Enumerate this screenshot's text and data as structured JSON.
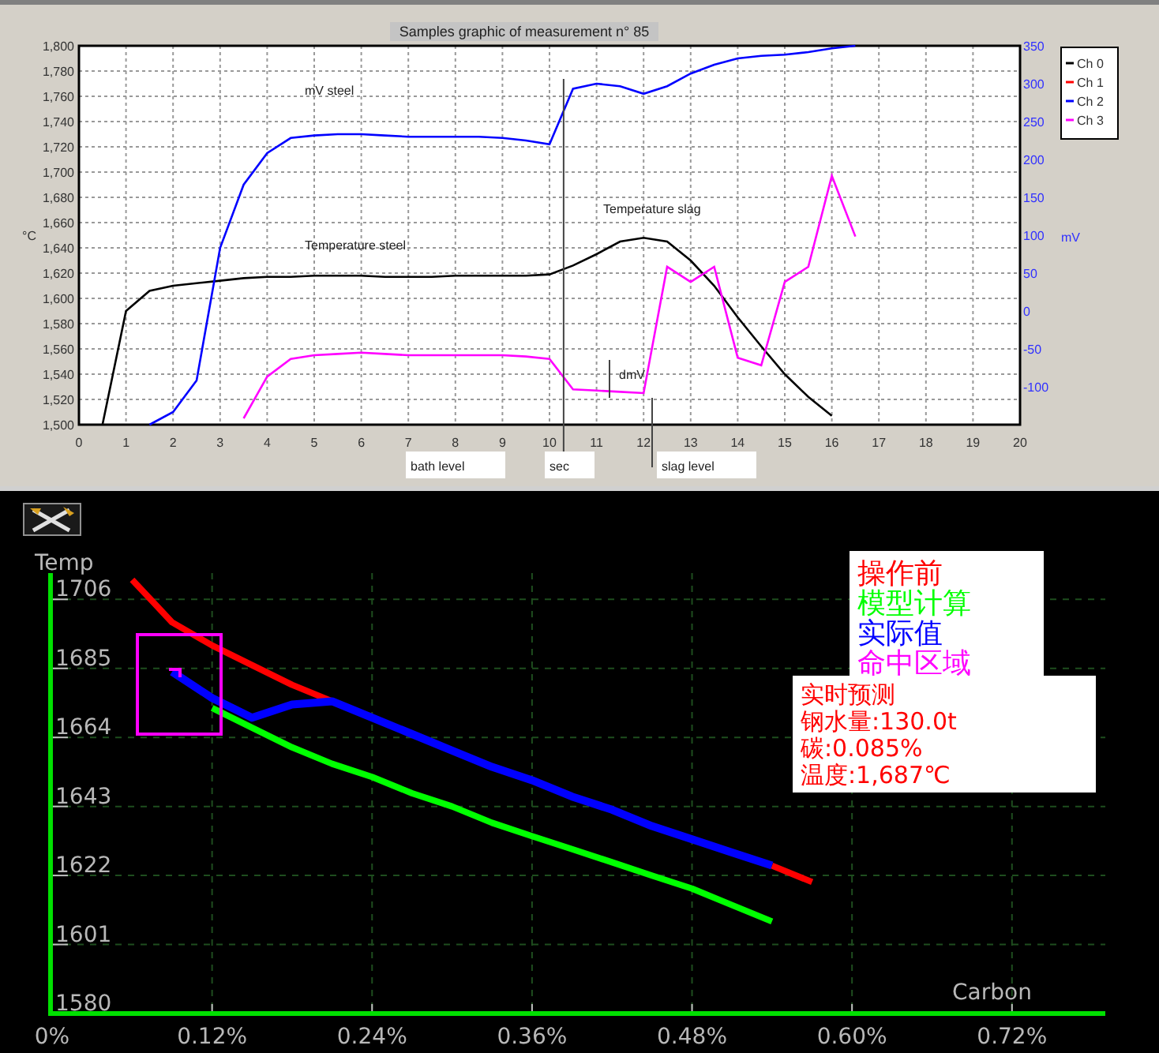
{
  "top_chart": {
    "title": "Samples graphic of measurement n° 85",
    "chart_data": {
      "type": "line",
      "ylabel": "°C",
      "y2label": "mV",
      "grid": true,
      "legend": true,
      "x": [
        0.5,
        1,
        1.5,
        2,
        2.5,
        3,
        3.5,
        4,
        4.5,
        5,
        5.5,
        6,
        6.5,
        7,
        7.5,
        8,
        8.5,
        9,
        9.5,
        10,
        10.5,
        11,
        11.5,
        12,
        12.5,
        13,
        13.5,
        14,
        14.5,
        15,
        15.5,
        16,
        16.5
      ],
      "xlim": [
        0,
        20
      ],
      "ylim": [
        1500,
        1800
      ],
      "y2lim": [
        -150,
        350
      ],
      "xticks": [
        0,
        1,
        2,
        3,
        4,
        5,
        6,
        7,
        8,
        9,
        10,
        11,
        12,
        13,
        14,
        15,
        16,
        17,
        18,
        19,
        20
      ],
      "yticks": [
        {
          "value": 1500,
          "label": "1,500"
        },
        {
          "value": 1520,
          "label": "1,520"
        },
        {
          "value": 1540,
          "label": "1,540"
        },
        {
          "value": 1560,
          "label": "1,560"
        },
        {
          "value": 1580,
          "label": "1,580"
        },
        {
          "value": 1600,
          "label": "1,600"
        },
        {
          "value": 1620,
          "label": "1,620"
        },
        {
          "value": 1640,
          "label": "1,640"
        },
        {
          "value": 1660,
          "label": "1,660"
        },
        {
          "value": 1680,
          "label": "1,680"
        },
        {
          "value": 1700,
          "label": "1,700"
        },
        {
          "value": 1720,
          "label": "1,720"
        },
        {
          "value": 1740,
          "label": "1,740"
        },
        {
          "value": 1760,
          "label": "1,760"
        },
        {
          "value": 1780,
          "label": "1,780"
        },
        {
          "value": 1800,
          "label": "1,800"
        }
      ],
      "y2ticks": [
        -100,
        -50,
        0,
        50,
        100,
        150,
        200,
        250,
        300,
        350
      ],
      "series": [
        {
          "name": "Ch 0",
          "color": "#000000",
          "values": [
            1500,
            1590,
            1606,
            1610,
            1612,
            1614,
            1616,
            1617,
            1617,
            1618,
            1618,
            1618,
            1617,
            1617,
            1617,
            1618,
            1618,
            1618,
            1618,
            1619,
            1626,
            1635,
            1645,
            1648,
            1645,
            1630,
            1610,
            1585,
            1562,
            1540,
            1522,
            1507,
            null
          ]
        },
        {
          "name": "Ch 1",
          "color": "#ff0000",
          "values": [
            null,
            null,
            null,
            null,
            null,
            null,
            null,
            null,
            null,
            null,
            null,
            null,
            null,
            null,
            null,
            null,
            null,
            null,
            null,
            null,
            null,
            null,
            null,
            null,
            null,
            null,
            null,
            null,
            null,
            null,
            null,
            null,
            null
          ]
        },
        {
          "name": "Ch 2",
          "color": "#0000ff",
          "values": [
            null,
            null,
            1500,
            1510,
            1535,
            1640,
            1690,
            1715,
            1727,
            1729,
            1730,
            1730,
            1729,
            1728,
            1728,
            1728,
            1728,
            1727,
            1725,
            1722,
            1766,
            1770,
            1768,
            1762,
            1768,
            1778,
            1785,
            1790,
            1792,
            1793,
            1795,
            1798,
            1800
          ]
        },
        {
          "name": "Ch 3",
          "color": "#ff00ff",
          "values": [
            null,
            null,
            null,
            null,
            null,
            null,
            1505,
            1538,
            1552,
            1555,
            1556,
            1557,
            1556,
            1555,
            1555,
            1555,
            1555,
            1555,
            1554,
            1552,
            1528,
            1527,
            1526,
            1525,
            1625,
            1613,
            1625,
            1553,
            1547,
            1613,
            1625,
            1697,
            1649
          ]
        }
      ],
      "ref_lines": [
        {
          "axis": "x",
          "value": 10.3
        }
      ],
      "annotations": [
        "mV steel",
        "Temperature steel",
        "Temperature slag",
        "dmV",
        "bath level",
        "sec",
        "slag level"
      ]
    }
  },
  "bottom_chart": {
    "chart_data": {
      "type": "line",
      "ylabel": "Temp",
      "xlabel": "Carbon",
      "grid": true,
      "legend": true,
      "x": [
        0.06,
        0.09,
        0.12,
        0.15,
        0.18,
        0.21,
        0.24,
        0.27,
        0.3,
        0.33,
        0.36,
        0.39,
        0.42,
        0.45,
        0.48,
        0.51,
        0.54,
        0.57
      ],
      "xlim": [
        0,
        0.79
      ],
      "ylim": [
        1580,
        1714
      ],
      "xticks": [
        {
          "value": 0,
          "label": "0%"
        },
        {
          "value": 0.12,
          "label": "0.12%"
        },
        {
          "value": 0.24,
          "label": "0.24%"
        },
        {
          "value": 0.36,
          "label": "0.36%"
        },
        {
          "value": 0.48,
          "label": "0.48%"
        },
        {
          "value": 0.6,
          "label": "0.60%"
        },
        {
          "value": 0.72,
          "label": "0.72%"
        }
      ],
      "yticks": [
        1580,
        1601,
        1622,
        1643,
        1664,
        1685,
        1706
      ],
      "series": [
        {
          "name": "操作前",
          "color": "#ff0000",
          "values": [
            1712,
            1699,
            1692,
            1686,
            1680,
            1675,
            null,
            null,
            null,
            null,
            null,
            null,
            null,
            null,
            null,
            null,
            1625,
            1620
          ]
        },
        {
          "name": "模型计算",
          "color": "#00ff00",
          "values": [
            null,
            null,
            1673,
            1667,
            1661,
            1656,
            1652,
            1647,
            1643,
            1638,
            1634,
            1630,
            1626,
            1622,
            1618,
            1613,
            1608,
            null
          ]
        },
        {
          "name": "实际值",
          "color": "#0000ff",
          "values": [
            null,
            1684,
            1676,
            1670,
            1674,
            1675,
            1670,
            1665,
            1660,
            1655,
            1651,
            1646,
            1642,
            1637,
            1633,
            1629,
            1625,
            null
          ]
        }
      ]
    },
    "hit_zone": {
      "label": "命中区域",
      "color": "#ff00ff"
    },
    "info": [
      "实时预测",
      "钢水量:130.0t",
      "碳:0.085%",
      "温度:1,687℃"
    ]
  }
}
